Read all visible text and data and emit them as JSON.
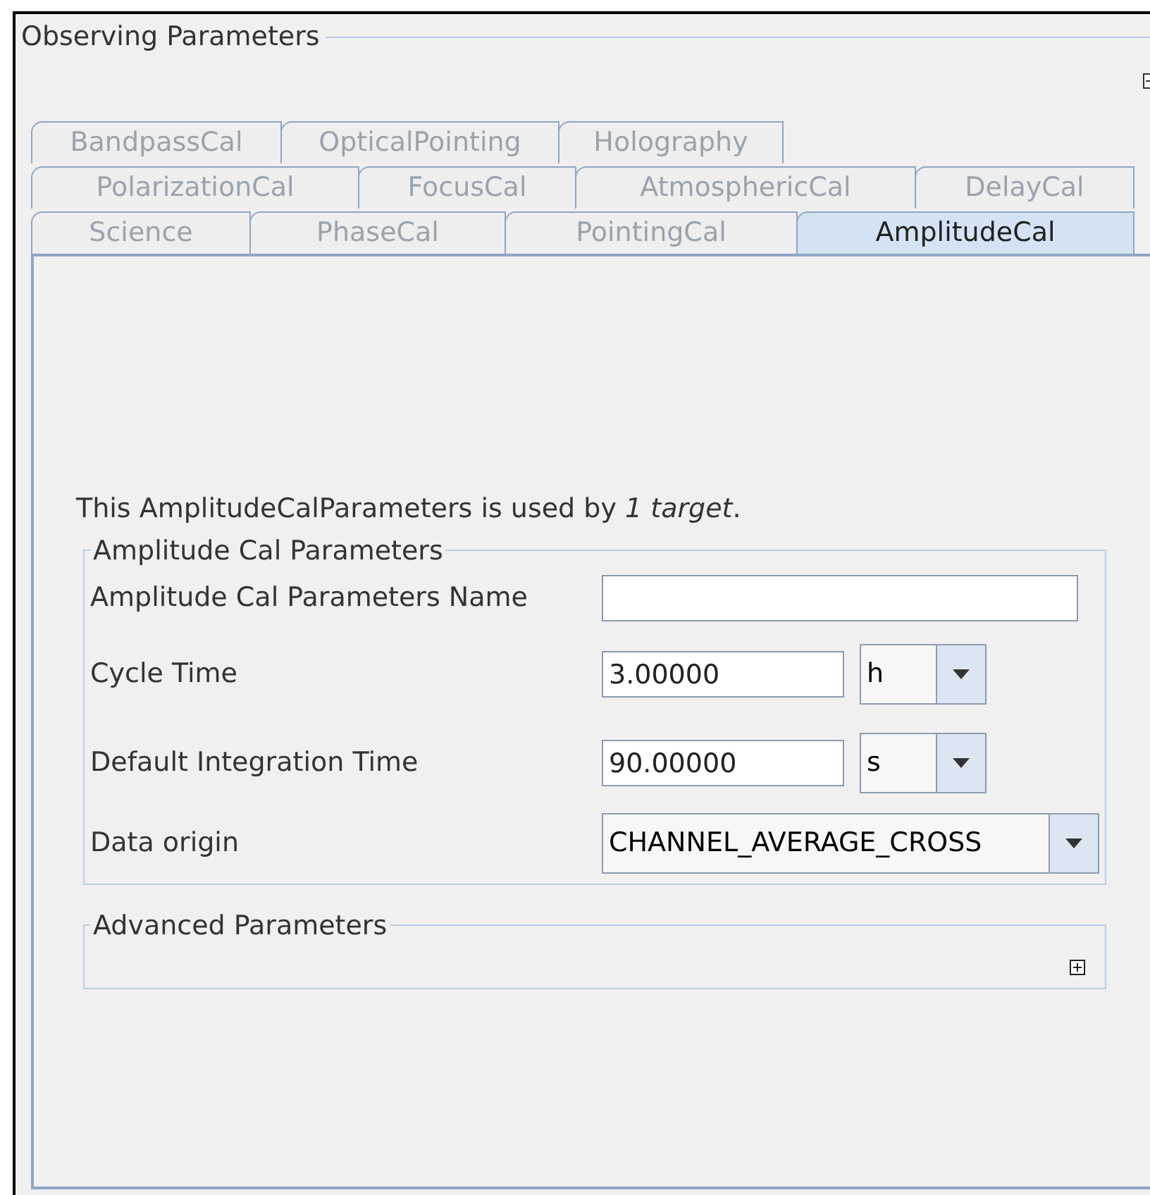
{
  "panel": {
    "title": "Observing Parameters"
  },
  "tab_rows": [
    [
      {
        "label": "BandpassCal",
        "selected": false
      },
      {
        "label": "OpticalPointing",
        "selected": false
      },
      {
        "label": "Holography",
        "selected": false
      }
    ],
    [
      {
        "label": "PolarizationCal",
        "selected": false
      },
      {
        "label": "FocusCal",
        "selected": false
      },
      {
        "label": "AtmosphericCal",
        "selected": false
      },
      {
        "label": "DelayCal",
        "selected": false
      }
    ],
    [
      {
        "label": "Science",
        "selected": false
      },
      {
        "label": "PhaseCal",
        "selected": false
      },
      {
        "label": "PointingCal",
        "selected": false
      },
      {
        "label": "AmplitudeCal",
        "selected": true
      }
    ]
  ],
  "usage_note": "This AmplitudeCalParameters is used by *1 target*.",
  "parameters": {
    "title": "Amplitude Cal Parameters",
    "fields": [
      {
        "kind": "text",
        "label": "Amplitude Cal Parameters Name"
      },
      {
        "kind": "unit",
        "label": "Cycle Time",
        "value": "3.00000",
        "unit": "h"
      },
      {
        "kind": "unit",
        "label": "Default Integration Time",
        "value": "90.00000",
        "unit": "s"
      },
      {
        "kind": "select",
        "label": "Data origin",
        "value": "CHANNEL_AVERAGE_CROSS"
      }
    ]
  },
  "advanced": {
    "title": "Advanced Parameters",
    "expanded": false
  }
}
